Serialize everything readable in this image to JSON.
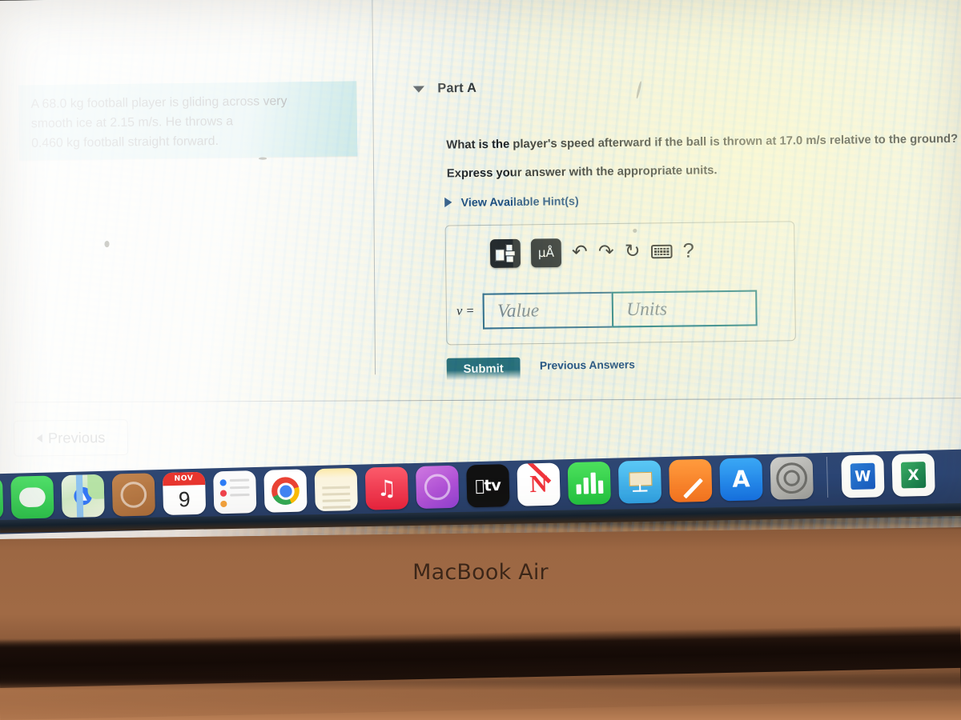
{
  "question": {
    "text_line1": "A 68.0 kg football player is gliding across very",
    "text_line2": "smooth ice at 2.15 m/s. He throws a",
    "text_line3": "0.460 kg football straight forward.",
    "highlight_color": "#a9dbdd"
  },
  "part": {
    "title": "Part A",
    "prompt": "What is the player's speed afterward if the ball is thrown at 17.0 m/s relative to the ground?",
    "instruction": "Express your answer with the appropriate units.",
    "hints_label": "View Available Hint(s)"
  },
  "answer": {
    "variable_label": "v =",
    "value_placeholder": "Value",
    "units_placeholder": "Units",
    "value_text": "",
    "units_text": "",
    "submit_label": "Submit",
    "previous_answers_label": "Previous Answers",
    "submit_color": "#1f6b7a",
    "link_color": "#15497e"
  },
  "toolbar": {
    "items": [
      {
        "name": "math-template-icon",
        "label": ""
      },
      {
        "name": "units-micro-angstrom-icon",
        "label": "μÅ"
      },
      {
        "name": "undo-icon",
        "label": "↶"
      },
      {
        "name": "redo-icon",
        "label": "↷"
      },
      {
        "name": "reset-icon",
        "label": "↻"
      },
      {
        "name": "keyboard-icon",
        "label": ""
      },
      {
        "name": "help-icon",
        "label": "?"
      }
    ]
  },
  "navigation": {
    "previous_label": "Previous"
  },
  "dock": {
    "items": [
      {
        "name": "facetime",
        "label": ""
      },
      {
        "name": "messages",
        "label": ""
      },
      {
        "name": "maps",
        "label": ""
      },
      {
        "name": "podcasts",
        "label": ""
      },
      {
        "name": "calendar",
        "month": "NOV",
        "day": "9"
      },
      {
        "name": "reminders",
        "label": ""
      },
      {
        "name": "chrome",
        "label": ""
      },
      {
        "name": "notes",
        "label": ""
      },
      {
        "name": "music",
        "label": "♫"
      },
      {
        "name": "podcasts-purple",
        "label": ""
      },
      {
        "name": "apple-tv",
        "label": "tv"
      },
      {
        "name": "news",
        "label": "N"
      },
      {
        "name": "numbers",
        "label": ""
      },
      {
        "name": "keynote",
        "label": ""
      },
      {
        "name": "pages",
        "label": ""
      },
      {
        "name": "app-store",
        "label": "A"
      },
      {
        "name": "system-preferences",
        "label": ""
      },
      {
        "name": "microsoft-word",
        "label": "W"
      },
      {
        "name": "microsoft-excel",
        "label": "X"
      }
    ],
    "background_color": "#2b4574"
  },
  "device": {
    "model_label": "MacBook Air",
    "body_color": "#9c6743"
  }
}
